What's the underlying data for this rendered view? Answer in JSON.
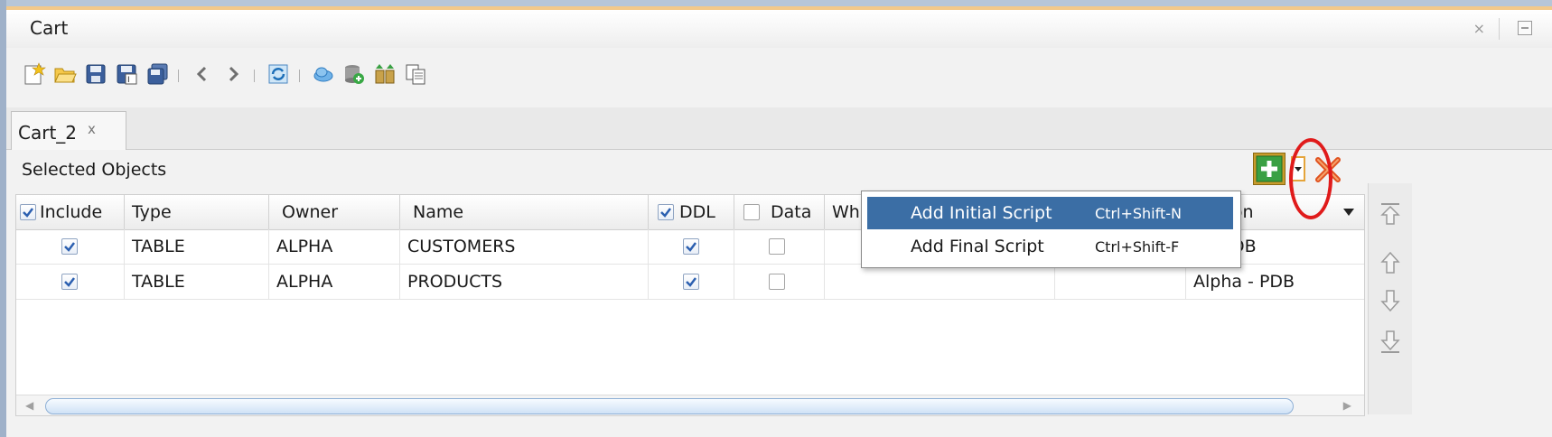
{
  "window": {
    "title": "Cart",
    "close_glyph": "×"
  },
  "toolbar": {
    "icons": [
      "new-cart-icon",
      "open-icon",
      "save-icon",
      "save-as-icon",
      "save-all-icon",
      "back-icon",
      "forward-icon",
      "refresh-icon",
      "cloud-icon",
      "deploy-icon",
      "compare-icon",
      "copy-icon"
    ]
  },
  "tabs": [
    {
      "label": "Cart_2",
      "close_glyph": "x"
    }
  ],
  "section": {
    "label": "Selected Objects"
  },
  "grid": {
    "headers": {
      "include": "Include",
      "type": "Type",
      "owner": "Owner",
      "name": "Name",
      "ddl": "DDL",
      "data": "Data",
      "where": "Wh",
      "connection": "nection"
    },
    "rows": [
      {
        "include": true,
        "type": "TABLE",
        "owner": "ALPHA",
        "name": "CUSTOMERS",
        "ddl": true,
        "data": false,
        "connection": "a - PDB"
      },
      {
        "include": true,
        "type": "TABLE",
        "owner": "ALPHA",
        "name": "PRODUCTS",
        "ddl": true,
        "data": false,
        "connection": "Alpha - PDB"
      }
    ]
  },
  "menu": {
    "items": [
      {
        "label": "Add Initial Script",
        "shortcut": "Ctrl+Shift-N",
        "selected": true
      },
      {
        "label": "Add Final Script",
        "shortcut": "Ctrl+Shift-F",
        "selected": false
      }
    ]
  },
  "colors": {
    "menu_highlight": "#3b6ea5",
    "annotation": "#e01b1b",
    "add_green": "#2e9e2e"
  }
}
